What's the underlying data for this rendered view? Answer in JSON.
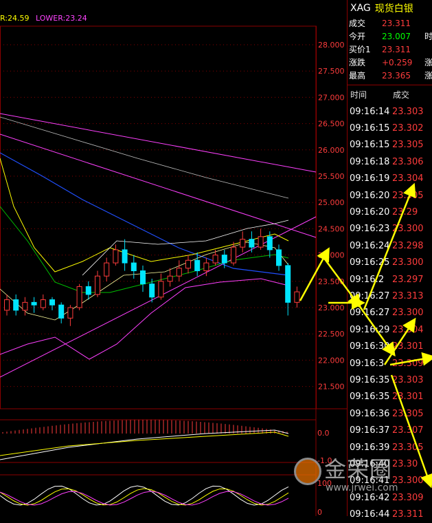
{
  "chart": {
    "upper_label": "R:24.59",
    "lower_label": "LOWER:23.24",
    "y_ticks": [
      "28.000",
      "27.500",
      "27.000",
      "26.500",
      "26.000",
      "25.500",
      "25.000",
      "24.500",
      "24.000",
      "23.500",
      "23.000",
      "22.500",
      "22.000",
      "21.500"
    ],
    "sub1_ticks": [
      "0.0",
      "-1.0"
    ],
    "sub2_ticks": [
      "100",
      "0"
    ],
    "colors": {
      "up": "#ff3c3c",
      "down": "#00e5ff",
      "ma_yellow": "#ffff00",
      "ma_green": "#00c000",
      "ma_blue": "#2050ff",
      "band_magenta": "#ff40ff",
      "grid": "#8b0000",
      "arrow": "#ffff00"
    }
  },
  "quote": {
    "code": "XAG",
    "name": "现货白银",
    "rows": [
      {
        "label": "成交",
        "value": "23.311",
        "color": "red"
      },
      {
        "label": "今开",
        "value": "23.007",
        "color": "green"
      },
      {
        "label": "买价1",
        "value": "23.311",
        "color": "red"
      },
      {
        "label": "涨跌",
        "value": "+0.259",
        "color": "red"
      },
      {
        "label": "最高",
        "value": "23.365",
        "color": "red"
      }
    ],
    "side_chars": [
      "",
      "时",
      "",
      "涨",
      "涨"
    ]
  },
  "ticks": {
    "header_time": "时间",
    "header_price": "成交",
    "rows": [
      {
        "time": "09:16:14",
        "price": "23.303"
      },
      {
        "time": "09:16:15",
        "price": "23.302"
      },
      {
        "time": "09:16:15",
        "price": "23.305"
      },
      {
        "time": "09:16:18",
        "price": "23.306"
      },
      {
        "time": "09:16:19",
        "price": "23.304"
      },
      {
        "time": "09:16:20",
        "price": "23.305"
      },
      {
        "time": "09:16:20",
        "price": "23.29"
      },
      {
        "time": "09:16:23",
        "price": "23.300"
      },
      {
        "time": "09:16:24",
        "price": "23.298"
      },
      {
        "time": "09:16:25",
        "price": "23.300"
      },
      {
        "time": "09:16:2",
        "price": "23.297"
      },
      {
        "time": "09:16:27",
        "price": "23.313"
      },
      {
        "time": "09:16:27",
        "price": "23.300"
      },
      {
        "time": "09:16:29",
        "price": "23.304"
      },
      {
        "time": "09:16:30",
        "price": "23.301"
      },
      {
        "time": "09:16:3",
        "price": "23.309"
      },
      {
        "time": "09:16:35",
        "price": "23.303"
      },
      {
        "time": "09:16:35",
        "price": "23.301"
      },
      {
        "time": "09:16:36",
        "price": "23.305"
      },
      {
        "time": "09:16:37",
        "price": "23.307"
      },
      {
        "time": "09:16:39",
        "price": "23.305"
      },
      {
        "time": "09:16:40",
        "price": "23.30"
      },
      {
        "time": "09:16:41",
        "price": "23.300"
      },
      {
        "time": "09:16:42",
        "price": "23.309"
      },
      {
        "time": "09:16:44",
        "price": "23.311"
      }
    ]
  },
  "watermark": {
    "brand": "金荣圈",
    "url": "www.jrwei.com"
  }
}
